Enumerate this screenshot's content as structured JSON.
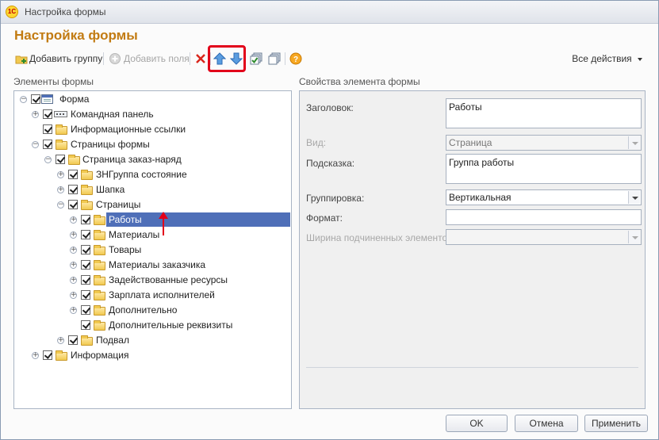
{
  "window": {
    "title": "Настройка формы"
  },
  "form": {
    "title": "Настройка формы"
  },
  "toolbar": {
    "add_group": "Добавить группу",
    "add_fields": "Добавить поля",
    "all_actions": "Все действия"
  },
  "left_panel": {
    "label": "Элементы формы"
  },
  "tree": [
    {
      "label": "Форма"
    },
    {
      "label": "Командная панель"
    },
    {
      "label": "Информационные ссылки"
    },
    {
      "label": "Страницы формы"
    },
    {
      "label": "Страница заказ-наряд"
    },
    {
      "label": "ЗНГруппа состояние"
    },
    {
      "label": "Шапка"
    },
    {
      "label": "Страницы"
    },
    {
      "label": "Работы"
    },
    {
      "label": "Материалы"
    },
    {
      "label": "Товары"
    },
    {
      "label": "Материалы заказчика"
    },
    {
      "label": "Задействованные ресурсы"
    },
    {
      "label": "Зарплата исполнителей"
    },
    {
      "label": "Дополнительно"
    },
    {
      "label": "Дополнительные реквизиты"
    },
    {
      "label": "Подвал"
    },
    {
      "label": "Информация"
    }
  ],
  "right_panel": {
    "label": "Свойства элемента формы",
    "title_label": "Заголовок:",
    "title_value": "Работы",
    "kind_label": "Вид:",
    "kind_value": "Страница",
    "hint_label": "Подсказка:",
    "hint_value": "Группа работы",
    "grouping_label": "Группировка:",
    "grouping_value": "Вертикальная",
    "format_label": "Формат:",
    "format_value": "",
    "width_label": "Ширина подчиненных элементов:",
    "width_value": ""
  },
  "buttons": {
    "ok": "OK",
    "cancel": "Отмена",
    "apply": "Применить"
  },
  "colors": {
    "accent": "#c27b12",
    "selection": "#4f6fb8",
    "highlight": "#e2001a"
  }
}
